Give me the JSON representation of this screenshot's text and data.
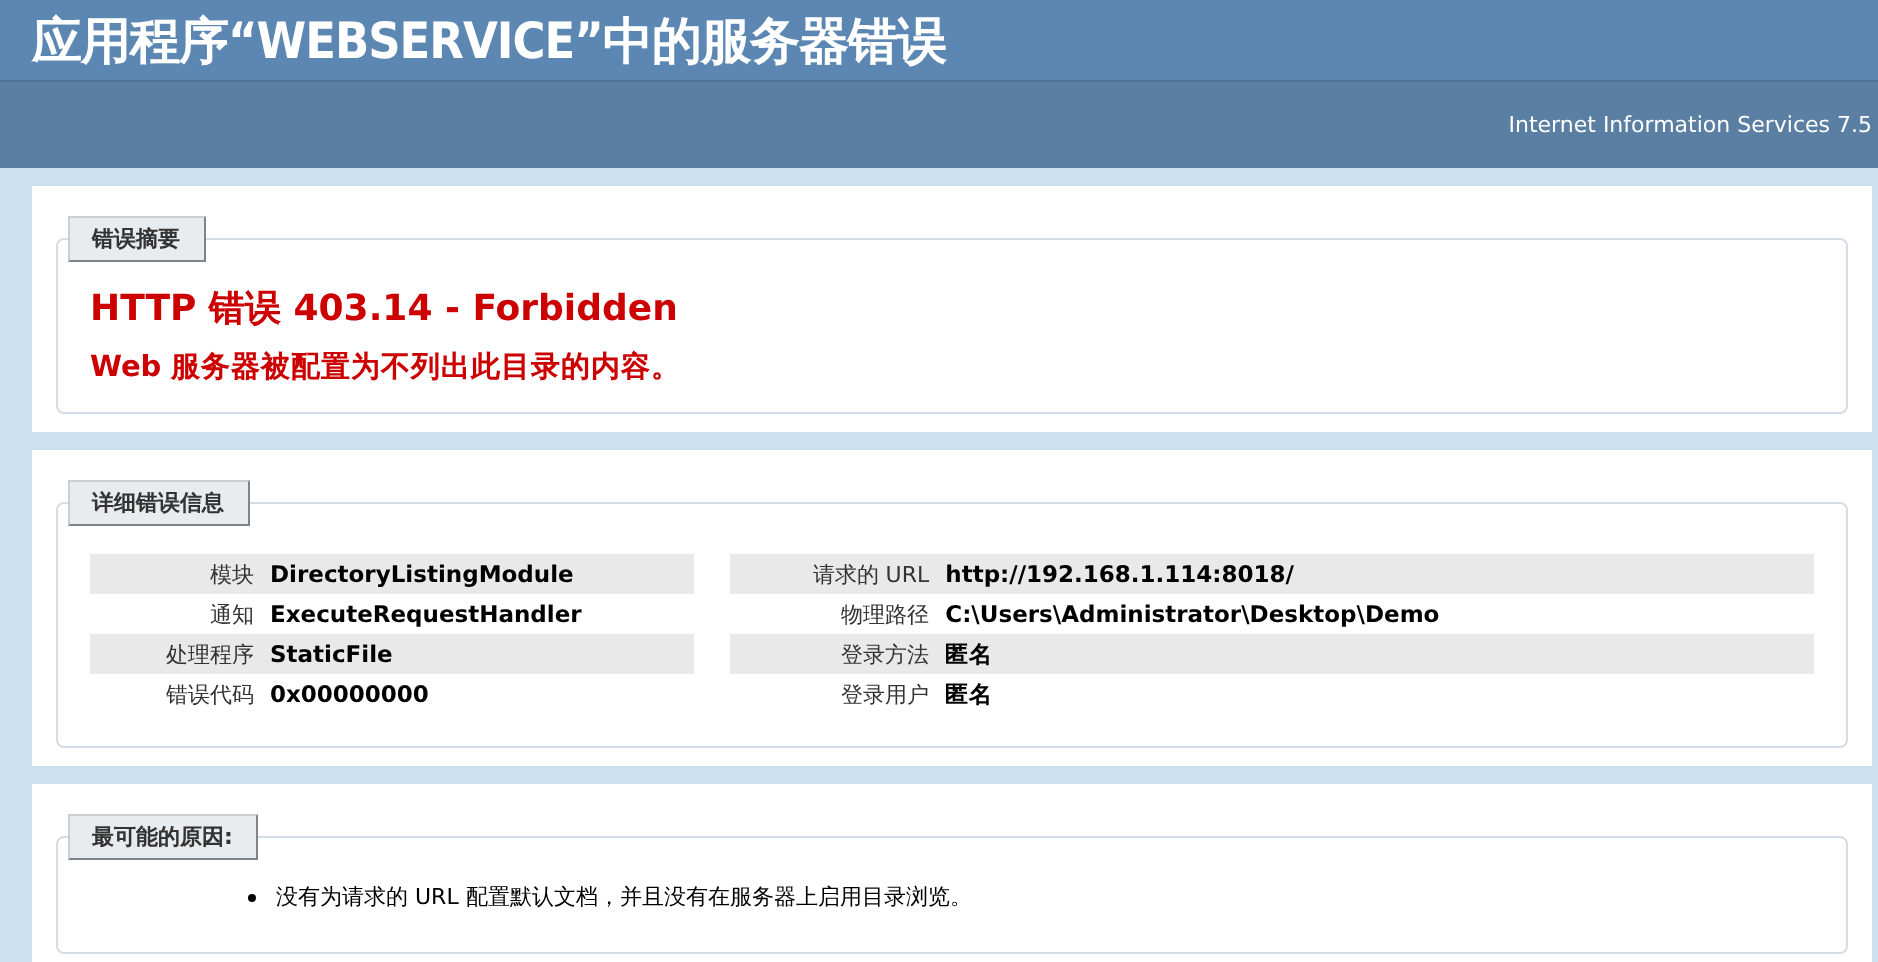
{
  "header": {
    "title": "应用程序“WEBSERVICE”中的服务器错误",
    "product": "Internet Information Services 7.5"
  },
  "summary": {
    "legend": "错误摘要",
    "heading": "HTTP 错误 403.14 - Forbidden",
    "message": "Web 服务器被配置为不列出此目录的内容。"
  },
  "details": {
    "legend": "详细错误信息",
    "left": [
      {
        "label": "模块",
        "value": "DirectoryListingModule"
      },
      {
        "label": "通知",
        "value": "ExecuteRequestHandler"
      },
      {
        "label": "处理程序",
        "value": "StaticFile"
      },
      {
        "label": "错误代码",
        "value": "0x00000000"
      }
    ],
    "right": [
      {
        "label": "请求的 URL",
        "value": "http://192.168.1.114:8018/"
      },
      {
        "label": "物理路径",
        "value": "C:\\Users\\Administrator\\Desktop\\Demo"
      },
      {
        "label": "登录方法",
        "value": "匿名"
      },
      {
        "label": "登录用户",
        "value": "匿名"
      }
    ]
  },
  "causes": {
    "legend": "最可能的原因:",
    "items": [
      "没有为请求的 URL 配置默认文档，并且没有在服务器上启用目录浏览。"
    ]
  }
}
